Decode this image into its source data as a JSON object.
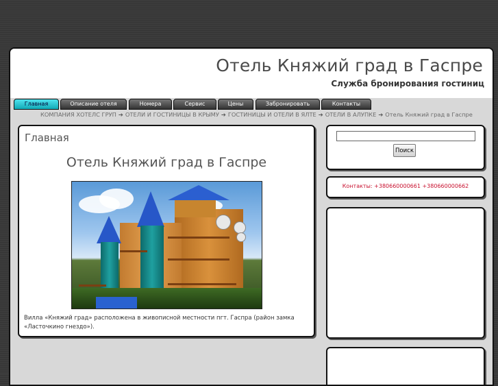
{
  "header": {
    "title": "Отель Княжий град в Гаспре",
    "subtitle": "Служба бронирования гостиниц"
  },
  "nav": {
    "items": [
      {
        "label": "Главная",
        "active": true
      },
      {
        "label": "Описание отеля"
      },
      {
        "label": "Номера"
      },
      {
        "label": "Сервис"
      },
      {
        "label": "Цены"
      },
      {
        "label": "Забронировать"
      },
      {
        "label": "Контакты"
      }
    ]
  },
  "breadcrumb": {
    "items": [
      "КОМПАНИЯ ХОТЕЛС ГРУП",
      "ОТЕЛИ И ГОСТИНИЦЫ В КРЫМУ",
      "ГОСТИНИЦЫ И ОТЕЛИ В ЯЛТЕ",
      "ОТЕЛИ В АЛУПКЕ",
      "Отель Княжий град в Гаспре"
    ],
    "separator": "➔"
  },
  "main": {
    "heading": "Главная",
    "hotel_title": "Отель Княжий град в Гаспре",
    "photo_icon": "hotel-photo",
    "description": "Вилла «Княжий град» расположена в живописной местности пгт. Гаспра (район замка «Ласточкино гнездо»)."
  },
  "sidebar": {
    "search": {
      "value": "",
      "button_label": "Поиск"
    },
    "contacts": "Контакты: +380660000661 +380660000662"
  },
  "colors": {
    "active_tab": "#1fc4d0",
    "contacts_text": "#c8102e",
    "page_bg": "#3a3a3a"
  }
}
